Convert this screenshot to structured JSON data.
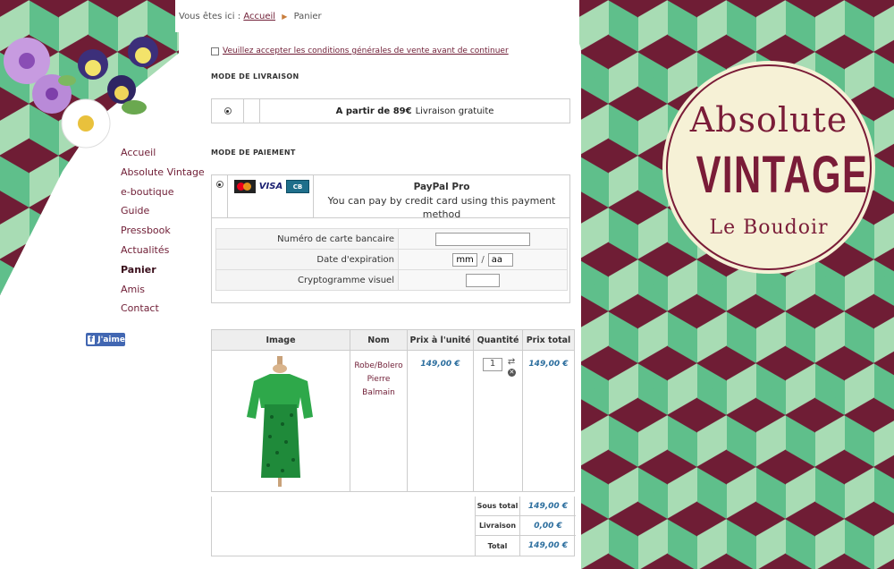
{
  "breadcrumb": {
    "prefix": "Vous êtes ici :",
    "home": "Accueil",
    "current": "Panier"
  },
  "terms": {
    "label": "Veuillez accepter les conditions générales de vente avant de continuer",
    "checked": false
  },
  "nav": {
    "items": [
      {
        "label": "Accueil"
      },
      {
        "label": "Absolute Vintage"
      },
      {
        "label": "e-boutique"
      },
      {
        "label": "Guide"
      },
      {
        "label": "Pressbook"
      },
      {
        "label": "Actualités"
      },
      {
        "label": "Panier",
        "active": true
      },
      {
        "label": "Amis"
      },
      {
        "label": "Contact"
      }
    ]
  },
  "facebook": {
    "like_label": "J'aime"
  },
  "shipping": {
    "title": "Mode de livraison",
    "option": {
      "bold": "A partir de 89€",
      "text": "Livraison gratuite",
      "selected": true
    }
  },
  "payment": {
    "title": "Mode de paiement",
    "method": {
      "name": "PayPal Pro",
      "description": "You can pay by credit card using this payment method",
      "selected": true
    },
    "cards": [
      "MasterCard",
      "VISA",
      "CB"
    ],
    "fields": {
      "card_number_label": "Numéro de carte bancaire",
      "expiry_label": "Date d'expiration",
      "expiry_month_placeholder": "mm",
      "expiry_year_placeholder": "aa",
      "cvv_label": "Cryptogramme visuel"
    }
  },
  "cart": {
    "headers": {
      "image": "Image",
      "name": "Nom",
      "unit_price": "Prix à l'unité",
      "quantity": "Quantité",
      "total": "Prix total"
    },
    "items": [
      {
        "name_line1": "Robe/Bolero",
        "name_line2": "Pierre",
        "name_line3": "Balmain",
        "unit_price": "149,00 €",
        "quantity": "1",
        "total": "149,00 €"
      }
    ],
    "summary": {
      "subtotal_label": "Sous total",
      "subtotal": "149,00 €",
      "shipping_label": "Livraison",
      "shipping": "0,00 €",
      "total_label": "Total",
      "total": "149,00 €"
    }
  },
  "logo": {
    "line1": "Absolute",
    "line2": "VINTAGE",
    "line3": "Le Boudoir"
  },
  "colors": {
    "burgundy": "#6f1d35",
    "mint": "#a8dcb4",
    "green": "#5fbf8b",
    "price_blue": "#2c6e9e"
  }
}
